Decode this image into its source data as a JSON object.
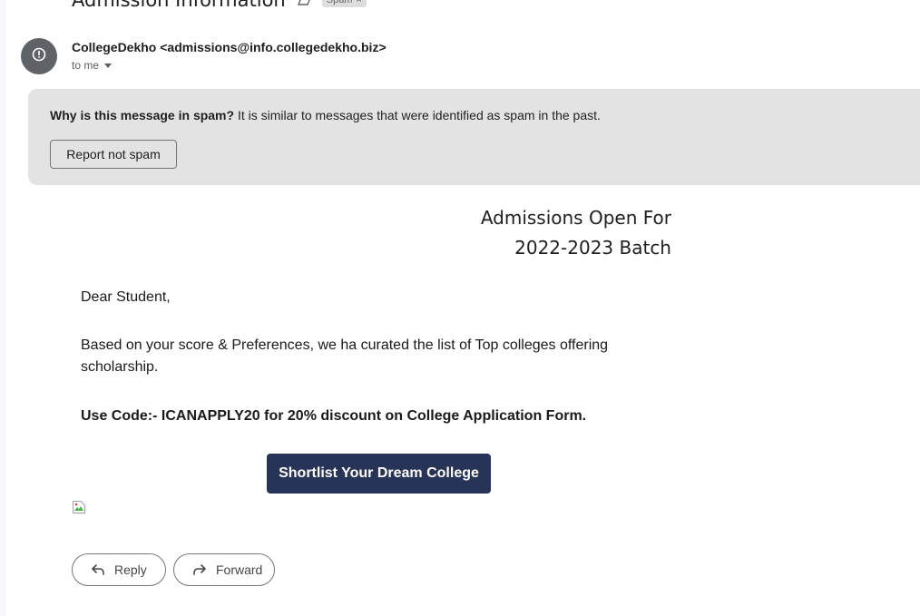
{
  "email": {
    "subject": "Admission Information",
    "label_chip": "Spam",
    "label_chip_close": "×",
    "sender": "CollegeDekho <admissions@info.collegedekho.biz>",
    "recipient_summary": "to me"
  },
  "spam_banner": {
    "question": "Why is this message in spam?",
    "reason": " It is similar to messages that were identified as spam in the past.",
    "report_button": "Report not spam"
  },
  "content": {
    "heading_line1": "Admissions Open For",
    "heading_line2": "2022-2023 Batch",
    "greeting": "Dear Student,",
    "paragraph": "Based on your score & Preferences, we ha curated the list of Top colleges offering scholarship.",
    "code_line": "Use Code:- ICANAPPLY20 for 20% discount on College Application Form.",
    "cta_button": "Shortlist Your Dream College"
  },
  "actions": {
    "reply": "Reply",
    "forward": "Forward"
  },
  "icons": {
    "avatar": "warning-circle-icon",
    "important": "important-marker-icon",
    "reply": "reply-arrow-icon",
    "forward": "forward-arrow-icon",
    "broken_image": "broken-image-icon"
  },
  "colors": {
    "cta_background": "#283358",
    "spam_banner_background": "#e3e3e3",
    "avatar_background": "#5f6368"
  }
}
